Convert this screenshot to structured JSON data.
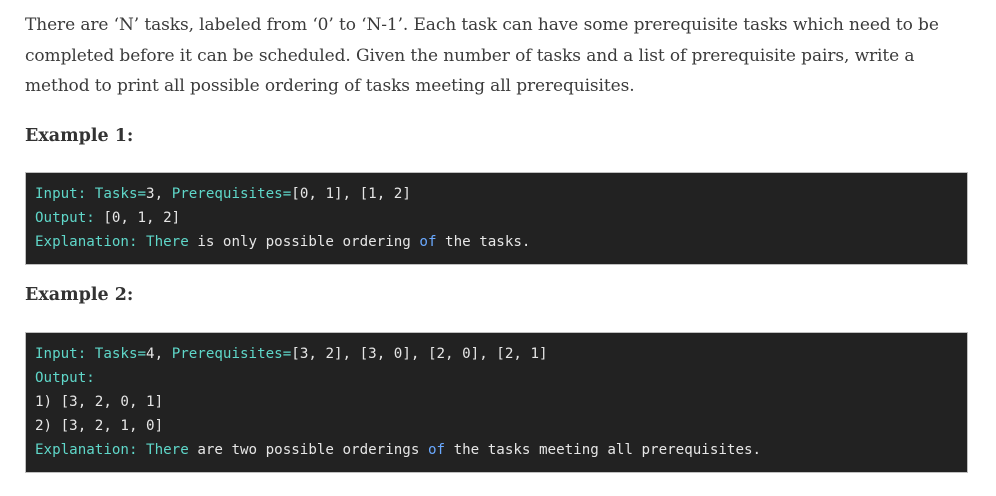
{
  "intro": {
    "line1": "There are ‘N’ tasks, labeled from ‘0’ to ‘N-1’. Each task can have some prerequisite tasks which need to be",
    "line2": "completed before it can be scheduled. Given the number of tasks and a list of prerequisite pairs, write a",
    "line3": "method to print all possible ordering of tasks meeting all prerequisites."
  },
  "example1": {
    "heading": "Example 1:",
    "input_label": "Input:",
    "input_tasks": "Tasks=",
    "input_tasks_val": "3,",
    "input_prereq": "Prerequisites=",
    "input_prereq_val": "[0, 1], [1, 2]",
    "output_label": "Output:",
    "output_val": "[0, 1, 2]",
    "expl_label": "Explanation:",
    "expl_there": "There",
    "expl_mid": "is only possible ordering",
    "expl_of": "of",
    "expl_end": "the tasks."
  },
  "example2": {
    "heading": "Example 2:",
    "input_label": "Input:",
    "input_tasks": "Tasks=",
    "input_tasks_val": "4,",
    "input_prereq": "Prerequisites=",
    "input_prereq_val": "[3, 2], [3, 0], [2, 0], [2, 1]",
    "output_label": "Output:",
    "order1": "1) [3, 2, 0, 1]",
    "order2": "2) [3, 2, 1, 0]",
    "expl_label": "Explanation:",
    "expl_there": "There",
    "expl_mid": "are two possible orderings",
    "expl_of": "of",
    "expl_end": "the tasks meeting all prerequisites."
  }
}
